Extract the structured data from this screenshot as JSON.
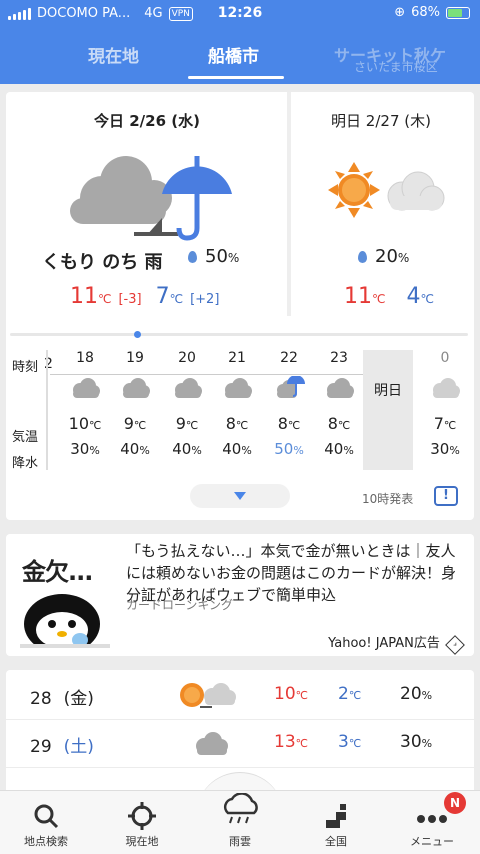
{
  "status_bar": {
    "carrier": "DOCOMO PA...",
    "network": "4G",
    "vpn": "VPN",
    "time": "12:26",
    "battery": "68%"
  },
  "tabs": [
    {
      "label": "現在地",
      "active": false
    },
    {
      "label": "船橋市",
      "active": true
    },
    {
      "label": "サーキット秋ケ",
      "sub": "さいたま市桜区",
      "active": false
    }
  ],
  "today": {
    "title": "今日 2/26 (水)",
    "condition": "くもり のち 雨",
    "rain_value": "50",
    "rain_unit": "%",
    "high": "11",
    "high_unit": "℃",
    "high_diff": "[-3]",
    "low": "7",
    "low_unit": "℃",
    "low_diff": "[+2]"
  },
  "tomorrow": {
    "title": "明日 2/27 (木)",
    "rain_value": "20",
    "rain_unit": "%",
    "high": "11",
    "high_unit": "℃",
    "low": "4",
    "low_unit": "℃"
  },
  "hourly": {
    "labels": {
      "time": "時刻",
      "temp": "気温",
      "precip": "降水"
    },
    "partial_left": "2",
    "columns": [
      {
        "hour": "18",
        "icon": "cloud-icon",
        "temp": "10",
        "precip": "30"
      },
      {
        "hour": "19",
        "icon": "cloud-icon",
        "temp": "9",
        "precip": "40"
      },
      {
        "hour": "20",
        "icon": "cloud-icon",
        "temp": "9",
        "precip": "40"
      },
      {
        "hour": "21",
        "icon": "cloud-icon",
        "temp": "8",
        "precip": "40"
      },
      {
        "hour": "22",
        "icon": "cloud-umbrella-icon",
        "temp": "8",
        "precip": "50"
      },
      {
        "hour": "23",
        "icon": "cloud-icon",
        "temp": "8",
        "precip": "40"
      }
    ],
    "next_day_label": "明日",
    "next": {
      "hour": "0",
      "icon": "cloud-icon",
      "temp": "7",
      "precip": "30"
    },
    "temp_unit": "℃",
    "precip_unit": "%",
    "issued": "10時発表",
    "info": "!"
  },
  "ad": {
    "image_text": "金欠...",
    "text": "「もう払えない…」本気で金が無いときは｜友人には頼めないお金の問題はこのカードが解決！身分証があればウェブで簡単申込",
    "source": "カードローンキング",
    "label": "Yahoo! JAPAN広告"
  },
  "daily": [
    {
      "day": "28",
      "weekday": "(金)",
      "icon": "sun-cloud-icon",
      "high": "10",
      "low": "2",
      "precip": "20"
    },
    {
      "day": "29",
      "weekday": "(土)",
      "icon": "cloud-icon",
      "high": "13",
      "low": "3",
      "precip": "30"
    }
  ],
  "bottom_nav": [
    {
      "label": "地点検索",
      "icon": "search-icon"
    },
    {
      "label": "現在地",
      "icon": "location-icon"
    },
    {
      "label": "雨雲",
      "icon": "rain-cloud-icon"
    },
    {
      "label": "全国",
      "icon": "map-icon"
    },
    {
      "label": "メニュー",
      "icon": "more-icon"
    }
  ],
  "menu_badge": "N",
  "colors": {
    "header": "#4a86e8",
    "high": "#e53935",
    "low": "#3f6fc5",
    "sun": "#f08a24"
  }
}
